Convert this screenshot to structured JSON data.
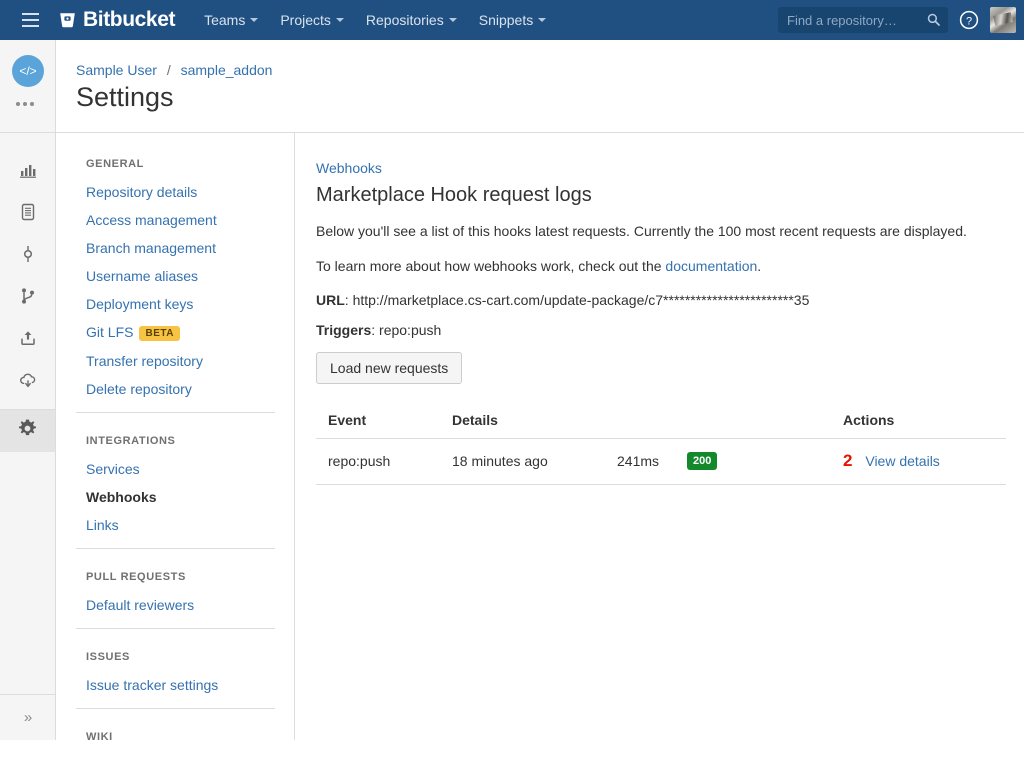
{
  "header": {
    "brand": "Bitbucket",
    "brand_logo_icon": "bitbucket-bucket-icon",
    "menu_icon": "hamburger-icon",
    "nav": [
      {
        "label": "Teams",
        "has_caret": true
      },
      {
        "label": "Projects",
        "has_caret": true
      },
      {
        "label": "Repositories",
        "has_caret": true
      },
      {
        "label": "Snippets",
        "has_caret": true
      }
    ],
    "search": {
      "placeholder": "Find a repository…",
      "value": "",
      "icon": "search-icon"
    },
    "help_icon": "help-circle-icon",
    "avatar_icon": "user-avatar",
    "background_color": "#205081"
  },
  "rail": {
    "repo_avatar_glyph": "</>",
    "repo_avatar_color": "#5ba4da",
    "overflow_icon": "ellipsis-icon",
    "items": [
      {
        "name": "overview",
        "icon": "bar-chart-icon",
        "active": false
      },
      {
        "name": "source",
        "icon": "file-document-icon",
        "active": false
      },
      {
        "name": "commits",
        "icon": "commit-node-icon",
        "active": false
      },
      {
        "name": "branches",
        "icon": "branch-fork-icon",
        "active": false
      },
      {
        "name": "pull-requests",
        "icon": "upload-box-icon",
        "active": false
      },
      {
        "name": "downloads",
        "icon": "cloud-download-icon",
        "active": false
      },
      {
        "name": "settings",
        "icon": "gear-icon",
        "active": true
      }
    ],
    "expand_label": "»"
  },
  "page": {
    "breadcrumb": {
      "owner": "Sample User",
      "separator": "/",
      "repo": "sample_addon"
    },
    "title": "Settings"
  },
  "sidenav": {
    "groups": [
      {
        "heading": "GENERAL",
        "links": [
          {
            "label": "Repository details",
            "active": false
          },
          {
            "label": "Access management",
            "active": false
          },
          {
            "label": "Branch management",
            "active": false
          },
          {
            "label": "Username aliases",
            "active": false
          },
          {
            "label": "Deployment keys",
            "active": false
          },
          {
            "label": "Git LFS",
            "active": false,
            "badge": "BETA"
          },
          {
            "label": "Transfer repository",
            "active": false
          },
          {
            "label": "Delete repository",
            "active": false
          }
        ]
      },
      {
        "heading": "INTEGRATIONS",
        "links": [
          {
            "label": "Services",
            "active": false
          },
          {
            "label": "Webhooks",
            "active": true
          },
          {
            "label": "Links",
            "active": false
          }
        ]
      },
      {
        "heading": "PULL REQUESTS",
        "links": [
          {
            "label": "Default reviewers",
            "active": false
          }
        ]
      },
      {
        "heading": "ISSUES",
        "links": [
          {
            "label": "Issue tracker settings",
            "active": false
          }
        ]
      },
      {
        "heading": "WIKI",
        "links": []
      }
    ]
  },
  "main": {
    "breadcrumb_link": "Webhooks",
    "title": "Marketplace Hook request logs",
    "description": "Below you'll see a list of this hooks latest requests. Currently the 100 most recent requests are displayed.",
    "learn_more_prefix": "To learn more about how webhooks work, check out the ",
    "learn_more_link": "documentation",
    "learn_more_suffix": ".",
    "url_label": "URL",
    "url_value": "http://marketplace.cs-cart.com/update-package/c7************************35",
    "triggers_label": "Triggers",
    "triggers_value": "repo:push",
    "load_button": "Load new requests",
    "table": {
      "columns": [
        "Event",
        "Details",
        "",
        "",
        "Actions"
      ],
      "rows": [
        {
          "event": "repo:push",
          "when": "18 minutes ago",
          "duration": "241ms",
          "status": "200",
          "status_color": "#14892c",
          "marker": "2",
          "marker_color": "#e51400",
          "action": "View details"
        }
      ]
    }
  }
}
